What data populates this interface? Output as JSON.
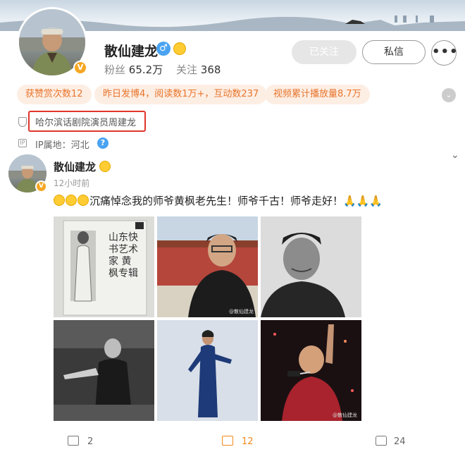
{
  "profile": {
    "name": "散仙建龙",
    "fans_label": "粉丝",
    "fans_count": "65.2万",
    "follow_label": "关注",
    "follow_count": "368",
    "verified_badge": "V",
    "gender_symbol": "♂"
  },
  "buttons": {
    "followed": "已关注",
    "message": "私信",
    "more": "•••"
  },
  "chips": [
    "获赞赏次数12",
    "昨日发博4，阅读数1万+，互动数237",
    "视频累计播放量8.7万"
  ],
  "chip_expand_icon": "chevron-down-icon",
  "certification": "哈尔滨话剧院演员周建龙",
  "ip": {
    "label": "IP属地：河北",
    "help": "?"
  },
  "post": {
    "author": "散仙建龙",
    "time": "12小时前",
    "text": "沉痛悼念我的师爷黄枫老先生！师爷千古！师爷走好！🙏🙏🙏",
    "images": [
      {
        "alt": "book-cover-huangfeng",
        "book_text": "山东快书艺术家 黄枫专辑"
      },
      {
        "alt": "portrait-tiananmen",
        "watermark": "@散仙建龙"
      },
      {
        "alt": "portrait-bw-smile"
      },
      {
        "alt": "stage-performance-bw"
      },
      {
        "alt": "performer-blue-gown"
      },
      {
        "alt": "singing-red-stage",
        "watermark": "@散仙建龙"
      }
    ],
    "reposts": "2",
    "comments": "12",
    "likes": "24"
  },
  "colors": {
    "chip_bg": "#fdeee4",
    "chip_text": "#e8742a",
    "highlight_border": "#e0352b",
    "comment_accent": "#f28a1c",
    "gender_blue": "#4aa3f0",
    "verified_gold": "#f6a623"
  }
}
